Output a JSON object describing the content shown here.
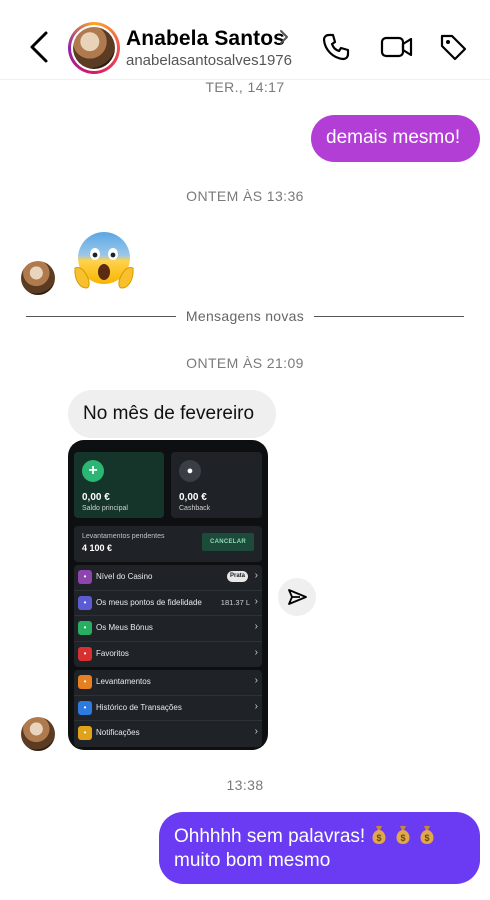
{
  "header": {
    "name": "Anabela Santos",
    "username": "anabelasantosalves1976",
    "icons": [
      "back-icon",
      "phone-icon",
      "video-icon",
      "tag-icon"
    ]
  },
  "messages": {
    "stamp1": "TER., 14:17",
    "msg1": "demais mesmo!",
    "stamp2": "ONTEM ÀS 13:36",
    "emoji": "face-screaming-in-fear",
    "divider": "Mensagens novas",
    "stamp3": "ONTEM ÀS 21:09",
    "msg2": "No mês de fevereiro",
    "stamp4": "13:38",
    "msg3_line1": "Ohhhhh sem palavras!",
    "msg3_line2": "muito bom mesmo"
  },
  "shot": {
    "card1_amount": "0,00 €",
    "card1_label": "Saldo principal",
    "card2_amount": "0,00 €",
    "card2_label": "Cashback",
    "pending_label": "Levantamentos pendentes",
    "pending_amount": "4 100 €",
    "cancel": "CANCELAR",
    "menu1": [
      {
        "label": "Nível do Casino",
        "badge": "Prata",
        "color": "#8e44ad"
      },
      {
        "label": "Os meus pontos de fidelidade",
        "right": "181.37 L",
        "color": "#5b5bd6"
      },
      {
        "label": "Os Meus Bónus",
        "color": "#27ae60"
      },
      {
        "label": "Favoritos",
        "color": "#d63031"
      }
    ],
    "menu2": [
      {
        "label": "Levantamentos",
        "color": "#e67e22"
      },
      {
        "label": "Histórico de Transações",
        "color": "#2d7be0"
      },
      {
        "label": "Notificações",
        "color": "#e1a21b"
      }
    ]
  },
  "colors": {
    "bubble_purple": "#b23ed6",
    "bubble_blue": "#6a3bf2",
    "bubble_gray": "#efefef"
  }
}
